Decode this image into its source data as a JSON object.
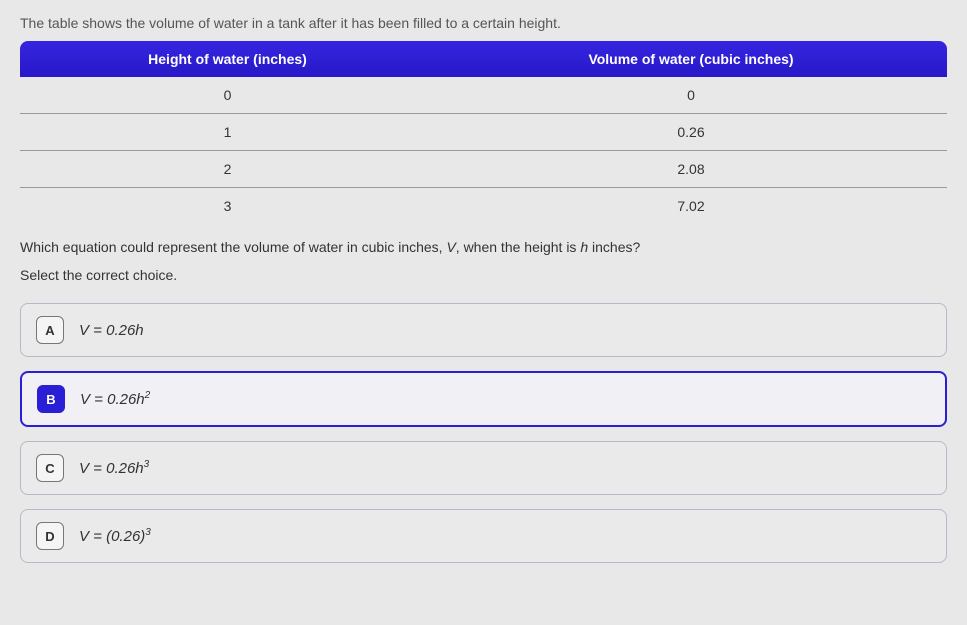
{
  "intro": "The table shows the volume of water in a tank after it has been filled to a certain height.",
  "table": {
    "headers": [
      "Height of water (inches)",
      "Volume of water (cubic inches)"
    ],
    "rows": [
      {
        "h": "0",
        "v": "0"
      },
      {
        "h": "1",
        "v": "0.26"
      },
      {
        "h": "2",
        "v": "2.08"
      },
      {
        "h": "3",
        "v": "7.02"
      }
    ]
  },
  "question_prefix": "Which equation could represent the volume of water in cubic inches, ",
  "question_var1": "V",
  "question_mid": ", when the height is ",
  "question_var2": "h",
  "question_suffix": " inches?",
  "select_prompt": "Select the correct choice.",
  "choices": {
    "a": {
      "letter": "A",
      "formula_prefix": "V = 0.26",
      "formula_var": "h",
      "formula_sup": ""
    },
    "b": {
      "letter": "B",
      "formula_prefix": "V = 0.26",
      "formula_var": "h",
      "formula_sup": "2"
    },
    "c": {
      "letter": "C",
      "formula_prefix": "V = 0.26",
      "formula_var": "h",
      "formula_sup": "3"
    },
    "d": {
      "letter": "D",
      "formula_prefix": "V = (0.26)",
      "formula_var": "",
      "formula_sup": "3"
    }
  },
  "chart_data": {
    "type": "table",
    "title": "Volume of water vs height",
    "columns": [
      "Height of water (inches)",
      "Volume of water (cubic inches)"
    ],
    "x": [
      0,
      1,
      2,
      3
    ],
    "y": [
      0,
      0.26,
      2.08,
      7.02
    ]
  }
}
